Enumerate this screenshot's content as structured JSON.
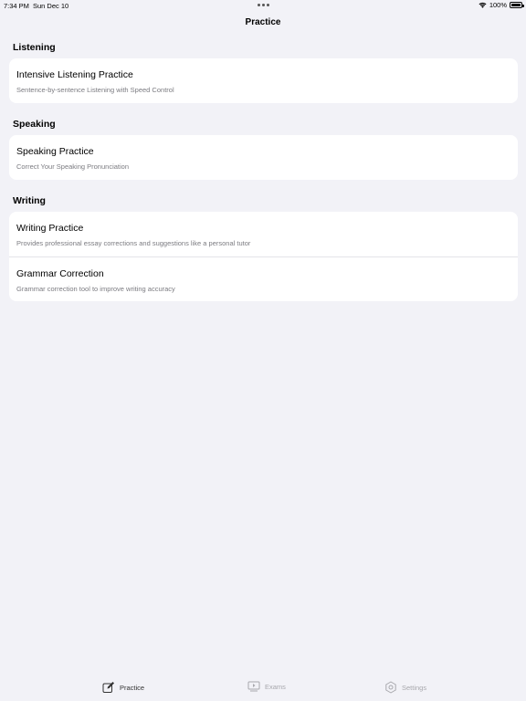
{
  "status": {
    "time": "7:34 PM",
    "date": "Sun Dec 10",
    "battery": "100%",
    "battery_level": 1.0
  },
  "nav": {
    "title": "Practice"
  },
  "sections": [
    {
      "header": "Listening",
      "items": [
        {
          "title": "Intensive Listening Practice",
          "subtitle": "Sentence-by-sentence Listening with Speed Control"
        }
      ]
    },
    {
      "header": "Speaking",
      "items": [
        {
          "title": "Speaking Practice",
          "subtitle": "Correct Your Speaking Pronunciation"
        }
      ]
    },
    {
      "header": "Writing",
      "items": [
        {
          "title": "Writing Practice",
          "subtitle": "Provides professional essay corrections and suggestions like a personal tutor"
        },
        {
          "title": "Grammar Correction",
          "subtitle": "Grammar correction tool to improve writing accuracy"
        }
      ]
    }
  ],
  "tabs": [
    {
      "label": "Practice",
      "icon": "square-pencil-icon",
      "active": true
    },
    {
      "label": "Exams",
      "icon": "play-rectangle-icon",
      "active": false
    },
    {
      "label": "Settings",
      "icon": "gear-icon",
      "active": false
    }
  ],
  "colors": {
    "background": "#f2f2f7",
    "card": "#ffffff",
    "subtitle": "#7b7b80",
    "tab_active": "#333333",
    "tab_inactive": "#a8a8ad"
  }
}
